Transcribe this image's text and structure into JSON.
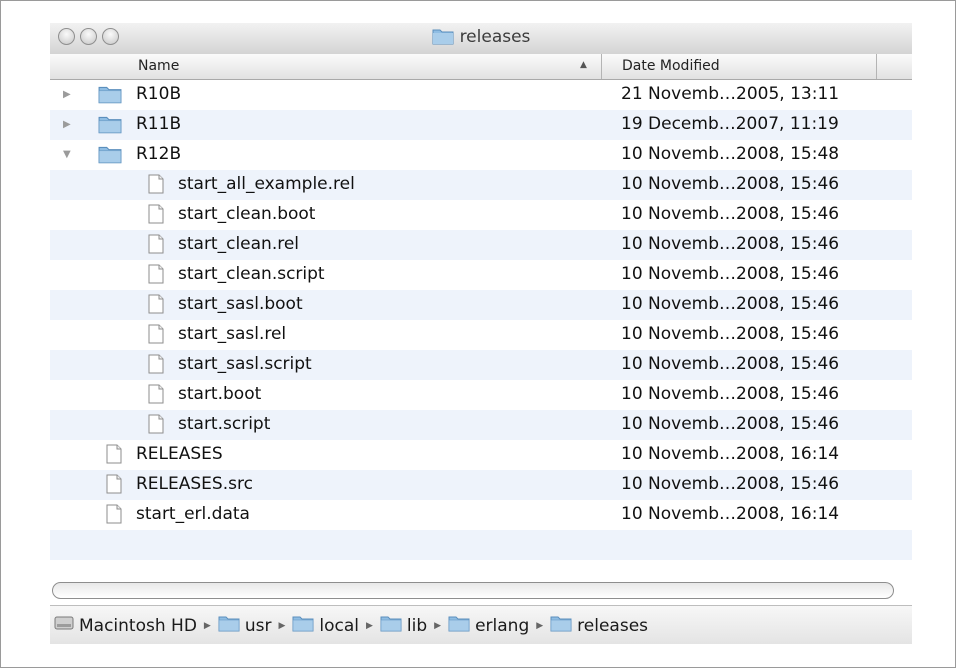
{
  "window": {
    "title": "releases"
  },
  "columns": {
    "name": "Name",
    "date": "Date Modified"
  },
  "rows": [
    {
      "name": "R10B",
      "date": "21 Novemb…2005, 13:11",
      "type": "folder",
      "level": 0,
      "disclosure": "collapsed"
    },
    {
      "name": "R11B",
      "date": "19 Decemb…2007, 11:19",
      "type": "folder",
      "level": 0,
      "disclosure": "collapsed"
    },
    {
      "name": "R12B",
      "date": "10 Novemb…2008, 15:48",
      "type": "folder",
      "level": 0,
      "disclosure": "expanded"
    },
    {
      "name": "start_all_example.rel",
      "date": "10 Novemb…2008, 15:46",
      "type": "file",
      "level": 1
    },
    {
      "name": "start_clean.boot",
      "date": "10 Novemb…2008, 15:46",
      "type": "file",
      "level": 1
    },
    {
      "name": "start_clean.rel",
      "date": "10 Novemb…2008, 15:46",
      "type": "file",
      "level": 1
    },
    {
      "name": "start_clean.script",
      "date": "10 Novemb…2008, 15:46",
      "type": "file",
      "level": 1
    },
    {
      "name": "start_sasl.boot",
      "date": "10 Novemb…2008, 15:46",
      "type": "file",
      "level": 1
    },
    {
      "name": "start_sasl.rel",
      "date": "10 Novemb…2008, 15:46",
      "type": "file",
      "level": 1
    },
    {
      "name": "start_sasl.script",
      "date": "10 Novemb…2008, 15:46",
      "type": "file",
      "level": 1
    },
    {
      "name": "start.boot",
      "date": "10 Novemb…2008, 15:46",
      "type": "file",
      "level": 1
    },
    {
      "name": "start.script",
      "date": "10 Novemb…2008, 15:46",
      "type": "file",
      "level": 1
    },
    {
      "name": "RELEASES",
      "date": "10 Novemb…2008, 16:14",
      "type": "file",
      "level": 0
    },
    {
      "name": "RELEASES.src",
      "date": "10 Novemb…2008, 15:46",
      "type": "file",
      "level": 0
    },
    {
      "name": "start_erl.data",
      "date": "10 Novemb…2008, 16:14",
      "type": "file",
      "level": 0
    }
  ],
  "path": [
    {
      "label": "Macintosh HD",
      "icon": "hard-drive-icon"
    },
    {
      "label": "usr",
      "icon": "folder-icon"
    },
    {
      "label": "local",
      "icon": "folder-icon"
    },
    {
      "label": "lib",
      "icon": "folder-icon"
    },
    {
      "label": "erlang",
      "icon": "folder-icon"
    },
    {
      "label": "releases",
      "icon": "folder-icon"
    }
  ],
  "colors": {
    "row_alt": "#eef3fb",
    "folder": "#7fb2dc"
  }
}
